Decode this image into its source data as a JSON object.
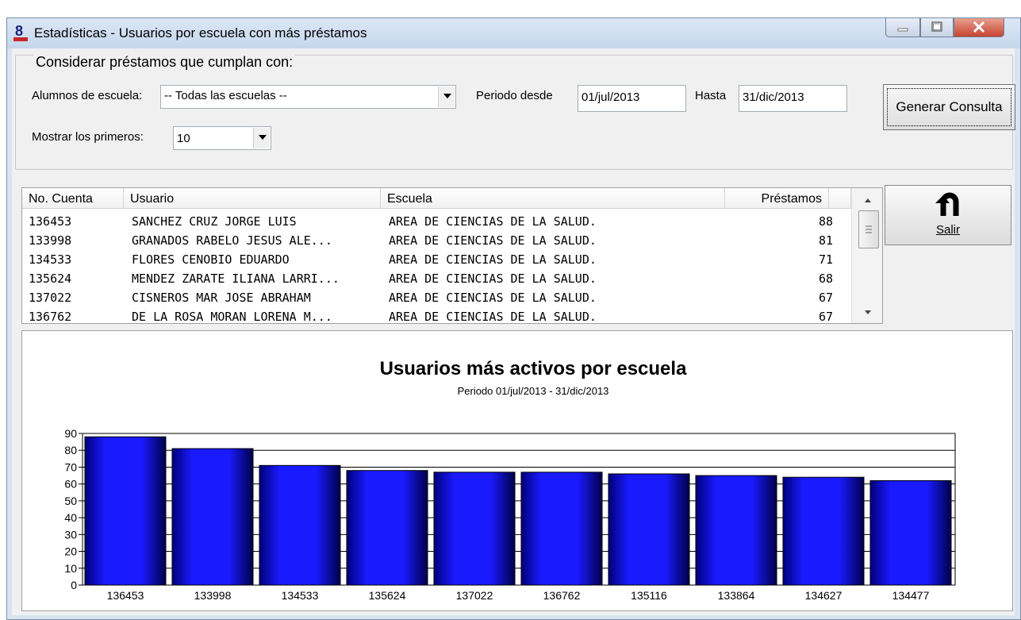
{
  "window": {
    "title": "Estadísticas - Usuarios por escuela con más préstamos",
    "app_icon": "sibibl-logo-icon",
    "controls": [
      "minimize-icon",
      "maximize-icon",
      "close-icon"
    ]
  },
  "filters": {
    "group_label": "Considerar préstamos que cumplan con:",
    "school_label": "Alumnos de escuela:",
    "school_value": "-- Todas las escuelas --",
    "top_label": "Mostrar los primeros:",
    "top_value": "10",
    "period_from_label": "Periodo desde",
    "period_from_value": "01/jul/2013",
    "period_to_label": "Hasta",
    "period_to_value": "31/dic/2013"
  },
  "buttons": {
    "generate_label": "Generar Consulta",
    "exit_label": "Salir",
    "exit_icon": "undo-arrow-icon"
  },
  "table": {
    "columns": [
      "No. Cuenta",
      "Usuario",
      "Escuela",
      "Préstamos"
    ],
    "rows": [
      {
        "cuenta": "136453",
        "usuario": "SANCHEZ CRUZ JORGE LUIS",
        "escuela": "AREA DE CIENCIAS DE LA SALUD.",
        "prestamos": "88"
      },
      {
        "cuenta": "133998",
        "usuario": "GRANADOS RABELO JESUS ALE...",
        "escuela": "AREA DE CIENCIAS DE LA SALUD.",
        "prestamos": "81"
      },
      {
        "cuenta": "134533",
        "usuario": "FLORES CENOBIO EDUARDO",
        "escuela": "AREA DE CIENCIAS DE LA SALUD.",
        "prestamos": "71"
      },
      {
        "cuenta": "135624",
        "usuario": "MENDEZ ZARATE ILIANA LARRI...",
        "escuela": "AREA DE CIENCIAS DE LA SALUD.",
        "prestamos": "68"
      },
      {
        "cuenta": "137022",
        "usuario": "CISNEROS MAR JOSE ABRAHAM",
        "escuela": "AREA DE CIENCIAS DE LA SALUD.",
        "prestamos": "67"
      },
      {
        "cuenta": "136762",
        "usuario": "DE LA ROSA MORAN LORENA M...",
        "escuela": "AREA DE CIENCIAS DE LA SALUD.",
        "prestamos": "67"
      }
    ]
  },
  "chart_data": {
    "type": "bar",
    "title": "Usuarios más activos por escuela",
    "subtitle": "Periodo 01/jul/2013 - 31/dic/2013",
    "categories": [
      "136453",
      "133998",
      "134533",
      "135624",
      "137022",
      "136762",
      "135116",
      "133864",
      "134627",
      "134477"
    ],
    "values": [
      88,
      81,
      71,
      68,
      67,
      67,
      66,
      65,
      64,
      62
    ],
    "yticks": [
      0,
      10,
      20,
      30,
      40,
      50,
      60,
      70,
      80,
      90
    ],
    "ylim": [
      0,
      90
    ],
    "bar_color": "#1a1aff",
    "grid": true
  }
}
